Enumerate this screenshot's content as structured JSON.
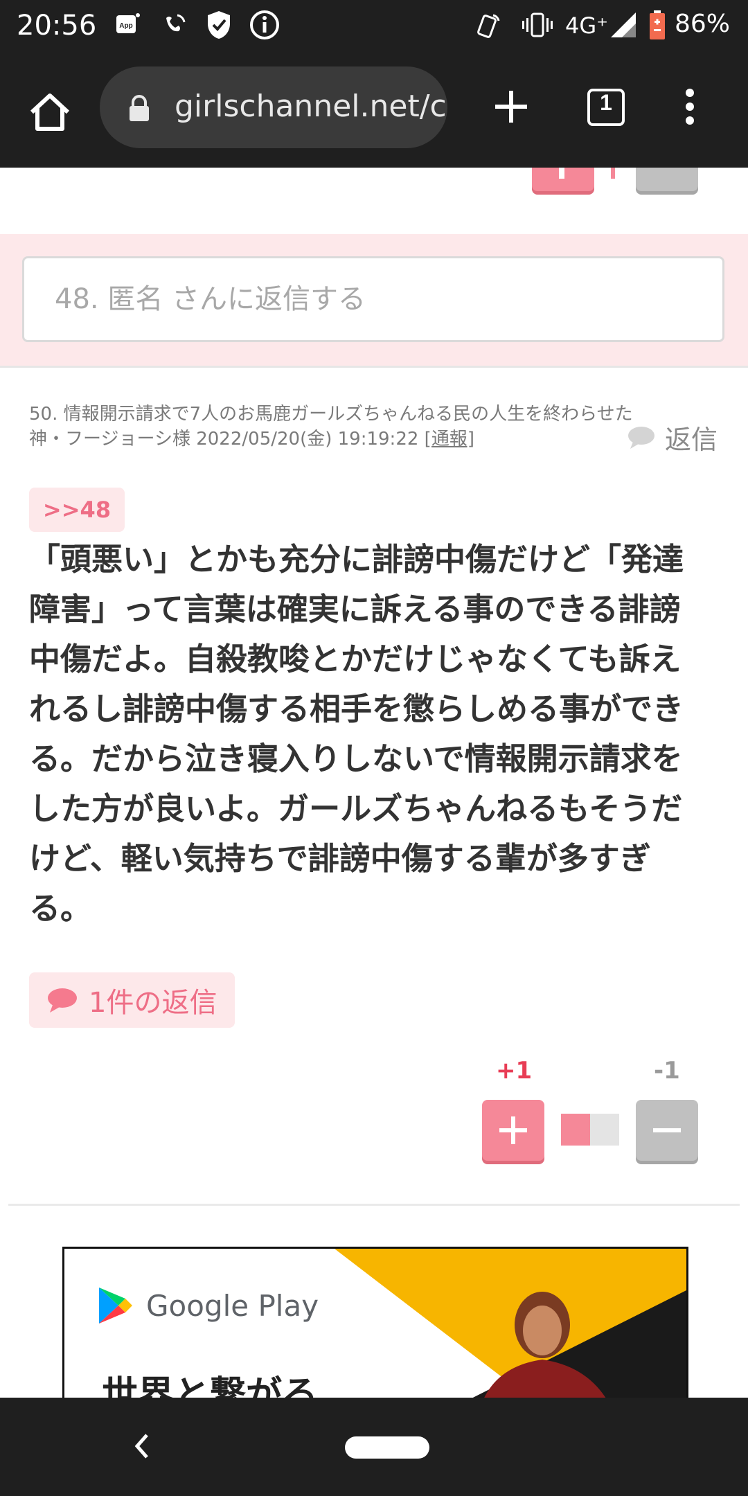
{
  "status_bar": {
    "time": "20:56",
    "network": "4G⁺",
    "battery": "86%",
    "icons": [
      "app-icon",
      "wifi-calling-icon",
      "shield-check-icon",
      "info-icon",
      "nfc-icon",
      "vibrate-icon",
      "signal-icon",
      "battery-icon"
    ]
  },
  "browser": {
    "url": "girlschannel.net/c",
    "tab_count": "1",
    "icons": [
      "home-icon",
      "lock-icon",
      "new-tab-icon",
      "tabs-icon",
      "menu-icon"
    ]
  },
  "reply_box": {
    "placeholder": "48. 匿名 さんに返信する"
  },
  "comment": {
    "header_line1": "50. 情報開示請求で7人のお馬鹿ガールズちゃんねる民の人生を終わらせた",
    "header_line2": "神・フージョーシ様 2022/05/20(金) 19:19:22 ",
    "report_label": "[通報]",
    "reply_label": "返信",
    "anchor": ">>48",
    "body": "「頭悪い」とかも充分に誹謗中傷だけど「発達障害」って言葉は確実に訴える事のできる誹謗中傷だよ。自殺教唆とかだけじゃなくても訴えれるし誹謗中傷する相手を懲らしめる事ができる。だから泣き寝入りしないで情報開示請求をした方が良いよ。ガールズちゃんねるもそうだけど、軽い気持ちで誹謗中傷する輩が多すぎる。",
    "replies_count_label": "1件の返信",
    "votes": {
      "plus_count": "+1",
      "minus_count": "-1",
      "plus_ratio": 0.5
    }
  },
  "ad": {
    "brand": "Google Play",
    "headline": "世界と繋がる"
  },
  "colors": {
    "pink": "#f58898",
    "pink_text": "#ee6e86",
    "pink_bg": "#fde8ea",
    "dark_bar": "#1f1f1f"
  }
}
